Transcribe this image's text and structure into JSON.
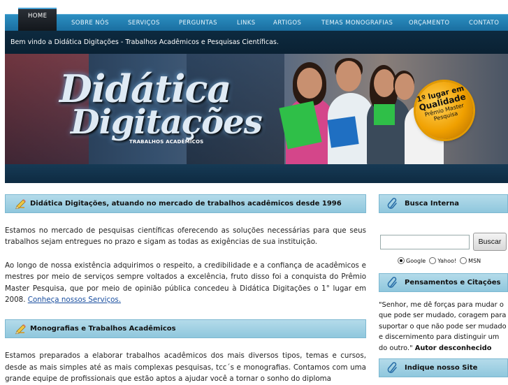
{
  "nav": {
    "items": [
      {
        "label": "HOME"
      },
      {
        "label": "SOBRE NÓS"
      },
      {
        "label": "SERVIÇOS"
      },
      {
        "label": "PERGUNTAS"
      },
      {
        "label": "LINKS"
      },
      {
        "label": "ARTIGOS"
      },
      {
        "label": "TEMAS MONOGRAFIAS"
      },
      {
        "label": "ORÇAMENTO"
      },
      {
        "label": "CONTATO"
      }
    ]
  },
  "welcome": "Bem vindo a Didática Digitações - Trabalhos Acadêmicos e Pesquisas Científicas.",
  "banner": {
    "logo_line1": "Didática",
    "logo_line2": "Digitações",
    "logo_sub": "TRABALHOS ACADÊMICOS",
    "seal_line1": "1º lugar em",
    "seal_line2": "Qualidade",
    "seal_line3": "Prêmio Master",
    "seal_line4": "Pesquisa"
  },
  "main": {
    "section1": {
      "title": "Didática Digitações, atuando no mercado de trabalhos acadêmicos desde 1996",
      "para1": "Estamos no mercado de pesquisas científicas oferecendo as soluções necessárias para que seus trabalhos sejam entregues no prazo e sigam as todas as exigências de sua instituição.",
      "para2": "Ao longo de nossa existência adquirimos o respeito, a credibilidade e a confiança de acadêmicos e mestres por meio de serviços sempre voltados a excelência, fruto disso foi a conquista do Prêmio Master Pesquisa, que por meio de opinião pública concedeu à Didática Digitações o 1° lugar em 2008.",
      "link": "Conheça nossos Serviços."
    },
    "section2": {
      "title": "Monografias e Trabalhos Acadêmicos",
      "para1": "Estamos preparados a elaborar trabalhos acadêmicos dos mais diversos tipos, temas e cursos, desde as mais simples até as mais complexas pesquisas, tcc´s e monografias. Contamos com uma grande equipe de profissionais que estão aptos a ajudar você a tornar o sonho do diploma"
    }
  },
  "sidebar": {
    "search": {
      "title": "Busca Interna",
      "value": "",
      "button": "Buscar",
      "options": [
        "Google",
        "Yahoo!",
        "MSN"
      ],
      "selected": "Google"
    },
    "quotes": {
      "title": "Pensamentos e Citações",
      "text": "\"Senhor, me dê forças para mudar o que pode ser mudado, coragem para suportar o que não pode ser mudado e discernimento para distinguir um do outro.\"",
      "author": "Autor desconhecido"
    },
    "indique": {
      "title": "Indique nosso Site"
    },
    "icon_pencil": "pencil-icon",
    "icon_clip": "paperclip-icon"
  },
  "colors": {
    "nav": "#1a6ea0",
    "welcome_bar": "#0a2133",
    "panel_head": "#a6d3e5"
  }
}
